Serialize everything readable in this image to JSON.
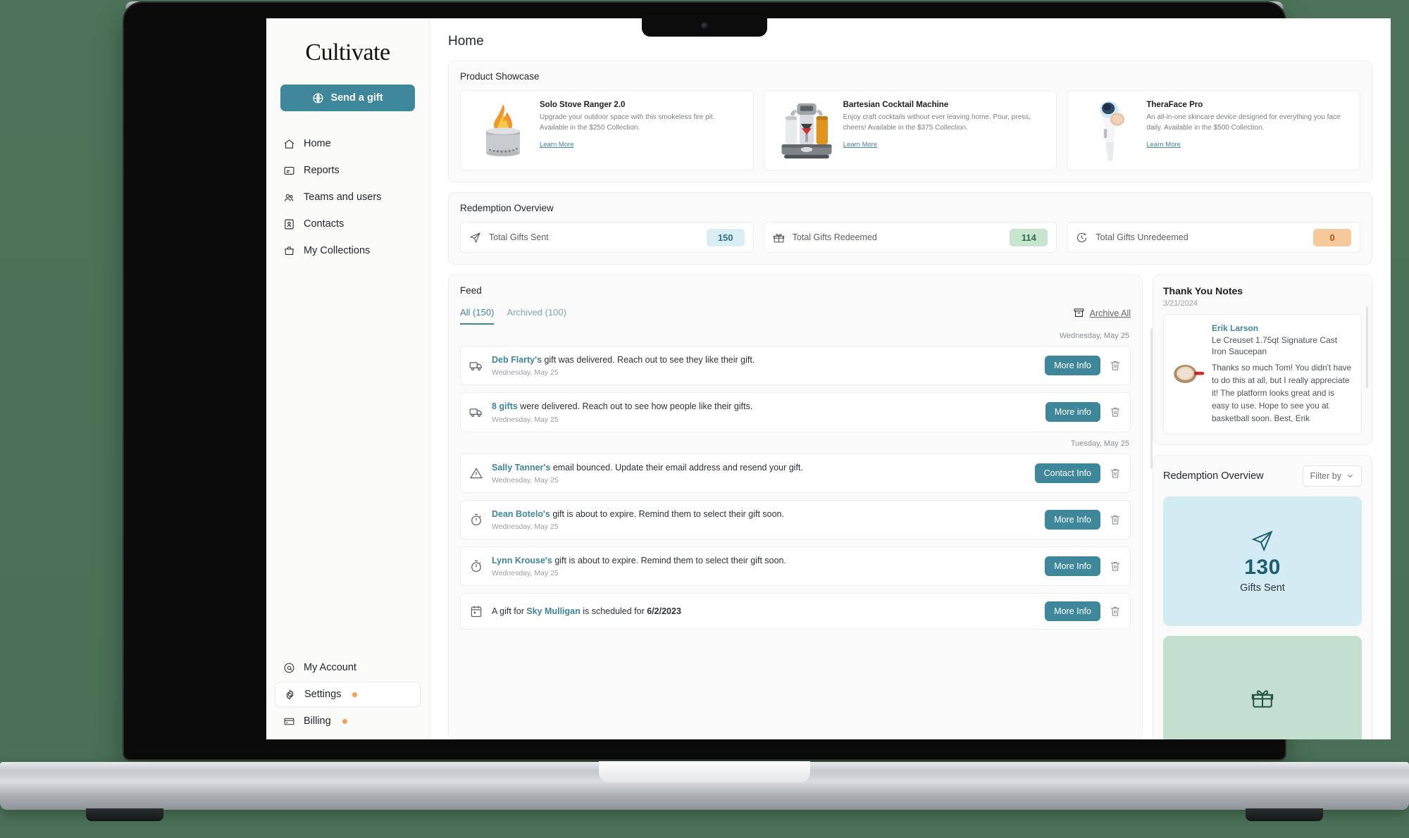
{
  "sidebar": {
    "logo": "Cultivate",
    "cta": {
      "label": "Send a gift",
      "icon": "gift-icon"
    },
    "items": [
      {
        "label": "Home",
        "icon": "home-icon"
      },
      {
        "label": "Reports",
        "icon": "report-icon"
      },
      {
        "label": "Teams and users",
        "icon": "users-icon"
      },
      {
        "label": "Contacts",
        "icon": "contacts-icon"
      },
      {
        "label": "My Collections",
        "icon": "bag-icon"
      }
    ],
    "bottom_items": [
      {
        "label": "My Account",
        "icon": "account-icon",
        "dot": false
      },
      {
        "label": "Settings",
        "icon": "gear-icon",
        "dot": true
      },
      {
        "label": "Billing",
        "icon": "card-icon",
        "dot": true
      }
    ],
    "dot_color": "#f0a05a"
  },
  "header": {
    "title": "Home"
  },
  "showcase": {
    "title": "Product Showcase",
    "products": [
      {
        "name": "Solo Stove Ranger 2.0",
        "description": "Upgrade your outdoor space with this smokeless fire pit. Available in the $250 Collection.",
        "link": "Learn More",
        "image": "fire-pit-image"
      },
      {
        "name": "Bartesian Cocktail Machine",
        "description": "Enjoy craft cocktails without ever leaving home. Pour, press, cheers! Available in the $375 Collection.",
        "link": "Learn More",
        "image": "cocktail-machine-image"
      },
      {
        "name": "TheraFace Pro",
        "description": "An all-in-one skincare device designed for everything you face daily. Available in the $500 Collection.",
        "link": "Learn More",
        "image": "theraface-image"
      }
    ]
  },
  "redemption_overview": {
    "title": "Redemption Overview",
    "stats": [
      {
        "label": "Total Gifts Sent",
        "value": "150",
        "icon": "send-icon",
        "color": "#d8eef3"
      },
      {
        "label": "Total Gifts Redeemed",
        "value": "114",
        "icon": "gift-icon",
        "color": "#c7e4cf"
      },
      {
        "label": "Total Gifts Unredeemed",
        "value": "0",
        "icon": "clock-icon",
        "color": "#f6c99b"
      }
    ]
  },
  "feed": {
    "title": "Feed",
    "tabs": [
      {
        "label": "All (150)",
        "active": true
      },
      {
        "label": "Archived (100)",
        "active": false
      }
    ],
    "archive_all": {
      "label": "Archive All",
      "icon": "archive-icon"
    },
    "groups": [
      {
        "day": "Wednesday, May 25",
        "items": [
          {
            "icon": "truck-icon",
            "who": "Deb Flarty's",
            "rest": " gift was delivered. Reach out to see they like their gift.",
            "date": "Wednesday, May 25",
            "action": "More Info"
          },
          {
            "icon": "truck-icon",
            "who": "8 gifts",
            "rest": " were delivered. Reach out to see how people like their gifts.",
            "date": "Wednesday, May 25",
            "action": "More info"
          }
        ]
      },
      {
        "day": "Tuesday, May 25",
        "items": [
          {
            "icon": "warning-icon",
            "who": "Sally Tanner's",
            "rest": " email bounced. Update their email address and resend your gift.",
            "date": "Wednesday, May 25",
            "action": "Contact Info"
          },
          {
            "icon": "stopwatch-icon",
            "who": "Dean Botelo's",
            "rest": " gift is about to expire. Remind them to select their gift soon.",
            "date": "Wednesday, May 25",
            "action": "More Info"
          },
          {
            "icon": "stopwatch-icon",
            "who": "Lynn Krouse's",
            "rest": " gift is about to expire. Remind them to select their gift soon.",
            "date": "Wednesday, May 25",
            "action": "More Info"
          },
          {
            "icon": "calendar-icon",
            "pre": "A gift for ",
            "who": "Sky Mulligan",
            "rest": " is scheduled for ",
            "bold_tail": "6/2/2023",
            "action": "More Info"
          }
        ]
      }
    ]
  },
  "thank_you_notes": {
    "title": "Thank You Notes",
    "date": "3/21/2024",
    "note": {
      "sender": "Erik Larson",
      "product": "Le Creuset 1.75qt Signature Cast Iron Saucepan",
      "message": "Thanks so much Tom! You didn't have to do this at all, but I really appreciate it! The platform looks great and is easy to use. Hope to see you at basketball soon. Best, Erik",
      "thumb": "saucepan-image"
    }
  },
  "side_redemption": {
    "title": "Redemption Overview",
    "filter": {
      "label": "Filter by",
      "icon": "chevron-down-icon"
    },
    "tiles": [
      {
        "value": "130",
        "label": "Gifts Sent",
        "icon": "send-icon",
        "color": "#d3ebf2"
      },
      {
        "value": "",
        "label": "",
        "icon": "gift-icon",
        "color": "#c3dfcf"
      }
    ]
  },
  "chart_data": {
    "type": "bar",
    "title": "Redemption Overview",
    "categories": [
      "Total Gifts Sent",
      "Total Gifts Redeemed",
      "Total Gifts Unredeemed"
    ],
    "values": [
      150,
      114,
      0
    ],
    "xlabel": "",
    "ylabel": "",
    "legend": []
  }
}
